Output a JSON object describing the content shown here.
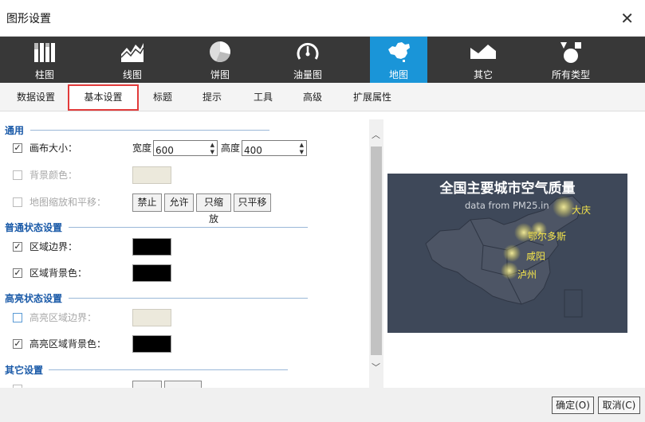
{
  "window": {
    "title": "图形设置",
    "close": "✕"
  },
  "chart_tabs": [
    {
      "label": "柱图"
    },
    {
      "label": "线图"
    },
    {
      "label": "饼图"
    },
    {
      "label": "油量图"
    },
    {
      "label": "地图",
      "active": true
    },
    {
      "label": "其它"
    },
    {
      "label": "所有类型"
    }
  ],
  "sub_tabs": [
    {
      "label": "数据设置"
    },
    {
      "label": "基本设置",
      "active": true
    },
    {
      "label": "标题"
    },
    {
      "label": "提示"
    },
    {
      "label": "工具"
    },
    {
      "label": "高级"
    },
    {
      "label": "扩展属性"
    }
  ],
  "form": {
    "general": {
      "heading": "通用",
      "canvas_size": {
        "label": "画布大小：",
        "checked": true,
        "width_label": "宽度",
        "width": "600",
        "height_label": "高度",
        "height": "400"
      },
      "bg_color": {
        "label": "背景颜色：",
        "checked": false,
        "color": "#ece9dc"
      },
      "zoom_pan": {
        "label": "地图缩放和平移：",
        "checked": false,
        "options": [
          "禁止",
          "允许",
          "只缩放",
          "只平移"
        ]
      }
    },
    "normal_state": {
      "heading": "普通状态设置",
      "border": {
        "label": "区域边界：",
        "checked": true,
        "color": "#000000"
      },
      "fill": {
        "label": "区域背景色：",
        "checked": true,
        "color": "#000000"
      }
    },
    "highlight_state": {
      "heading": "高亮状态设置",
      "border": {
        "label": "高亮区域边界：",
        "checked": false,
        "color": "#ece9dc"
      },
      "fill": {
        "label": "高亮区域背景色：",
        "checked": true,
        "color": "#000000"
      }
    },
    "other": {
      "heading": "其它设置"
    }
  },
  "preview": {
    "title": "全国主要城市空气质量",
    "subtitle": "data from PM25.in",
    "cities": [
      "大庆",
      "鄂尔多斯",
      "咸阳",
      "泸州"
    ]
  },
  "footer": {
    "ok": "确定(O)",
    "cancel": "取消(C)"
  },
  "colors": {
    "accent": "#1a95d8",
    "tab_bar": "#383838",
    "highlight_border": "#e23b3b",
    "section_text": "#1a5aa8",
    "marker": "#f6e64a",
    "map_bg": "#3e4859"
  }
}
